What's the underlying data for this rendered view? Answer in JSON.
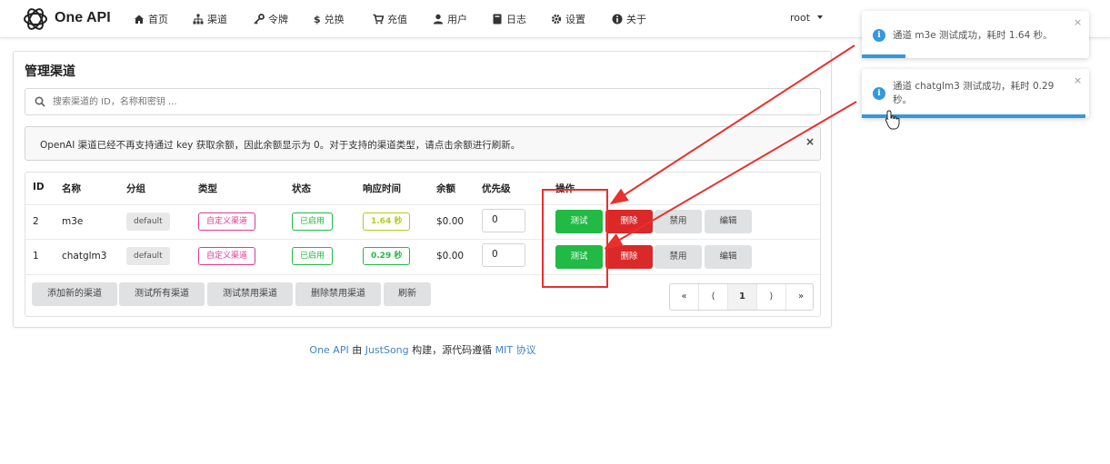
{
  "nav": {
    "brand": "One API",
    "items": [
      "首页",
      "渠道",
      "令牌",
      "兑换",
      "充值",
      "用户",
      "日志",
      "设置",
      "关于"
    ],
    "user": "root"
  },
  "page": {
    "title": "管理渠道",
    "search_placeholder": "搜索渠道的 ID，名称和密钥 ...",
    "notice": "OpenAI 渠道已经不再支持通过 key 获取余额，因此余额显示为 0。对于支持的渠道类型，请点击余额进行刷新。",
    "notice_close": "×"
  },
  "table": {
    "headers": [
      "ID",
      "名称",
      "分组",
      "类型",
      "状态",
      "响应时间",
      "余额",
      "优先级",
      "操作"
    ],
    "rows": [
      {
        "id": "2",
        "name": "m3e",
        "group": "default",
        "type": "自定义渠道",
        "status": "已启用",
        "response_time": "1.64 秒",
        "balance": "$0.00",
        "priority": "0"
      },
      {
        "id": "1",
        "name": "chatglm3",
        "group": "default",
        "type": "自定义渠道",
        "status": "已启用",
        "response_time": "0.29 秒",
        "balance": "$0.00",
        "priority": "0"
      }
    ],
    "actions": {
      "test": "测试",
      "delete": "删除",
      "disable": "禁用",
      "edit": "编辑"
    }
  },
  "footer_buttons": [
    "添加新的渠道",
    "测试所有渠道",
    "测试禁用渠道",
    "删除禁用渠道",
    "刷新"
  ],
  "pagination": {
    "first": "«",
    "prev": "⟨",
    "current": "1",
    "next": "⟩",
    "last": "»"
  },
  "footer": {
    "project": "One API",
    "by": " 由 ",
    "author": "JustSong",
    "middle": " 构建，源代码遵循 ",
    "license": "MIT 协议"
  },
  "toasts": [
    {
      "message": "通道 m3e 测试成功，耗时 1.64 秒。",
      "close": "×"
    },
    {
      "message": "通道 chatglm3 测试成功，耗时 0.29 秒。",
      "close": "×"
    }
  ],
  "colors": {
    "green": "#21ba45",
    "red": "#db2828",
    "pink": "#e03997",
    "olive": "#b5cc18",
    "blue": "#3498db",
    "link": "#4183c4",
    "annotation": "#e8302c"
  }
}
